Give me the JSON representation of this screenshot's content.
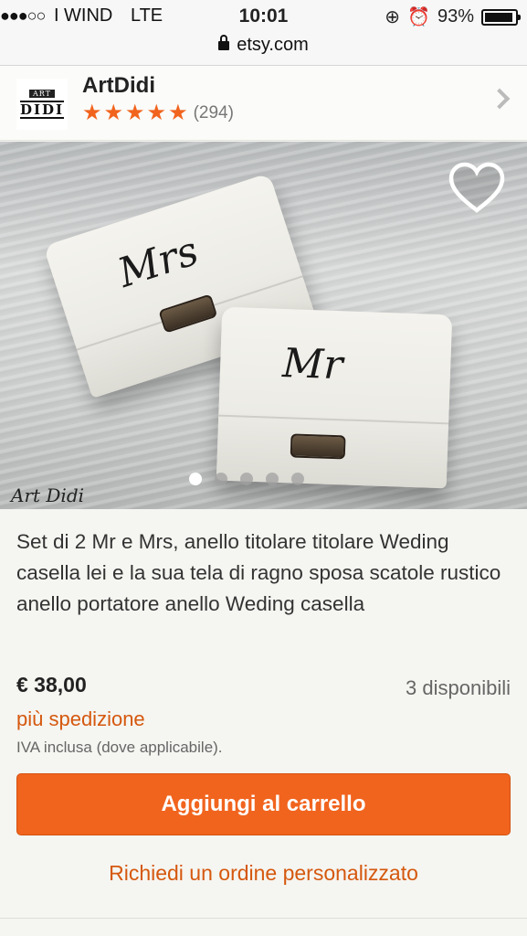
{
  "status_bar": {
    "signal": "●●●○○",
    "carrier": "I WIND",
    "network": "LTE",
    "time": "10:01",
    "battery": "93%",
    "battery_level": 0.93
  },
  "browser": {
    "url": "etsy.com"
  },
  "shop": {
    "logo_line1": "ART",
    "logo_line2": "DIDI",
    "name": "ArtDidi",
    "stars": 5,
    "reviews": "(294)"
  },
  "gallery": {
    "watermark": "Art Didi",
    "box1_monogram": "Mrs",
    "box2_monogram": "Mr",
    "image_count": 5,
    "active_index": 0
  },
  "product": {
    "title": "Set di 2 Mr e Mrs, anello titolare titolare Weding casella lei e la sua tela di ragno sposa scatole rustico anello portatore anello Weding casella",
    "price": "€ 38,00",
    "availability": "3 disponibili",
    "shipping": "più spedizione",
    "vat": "IVA inclusa (dove applicabile).",
    "add_to_cart": "Aggiungi al carrello",
    "custom_order": "Richiedi un ordine personalizzato"
  },
  "colors": {
    "accent": "#f1641e",
    "link": "#d5580e"
  }
}
